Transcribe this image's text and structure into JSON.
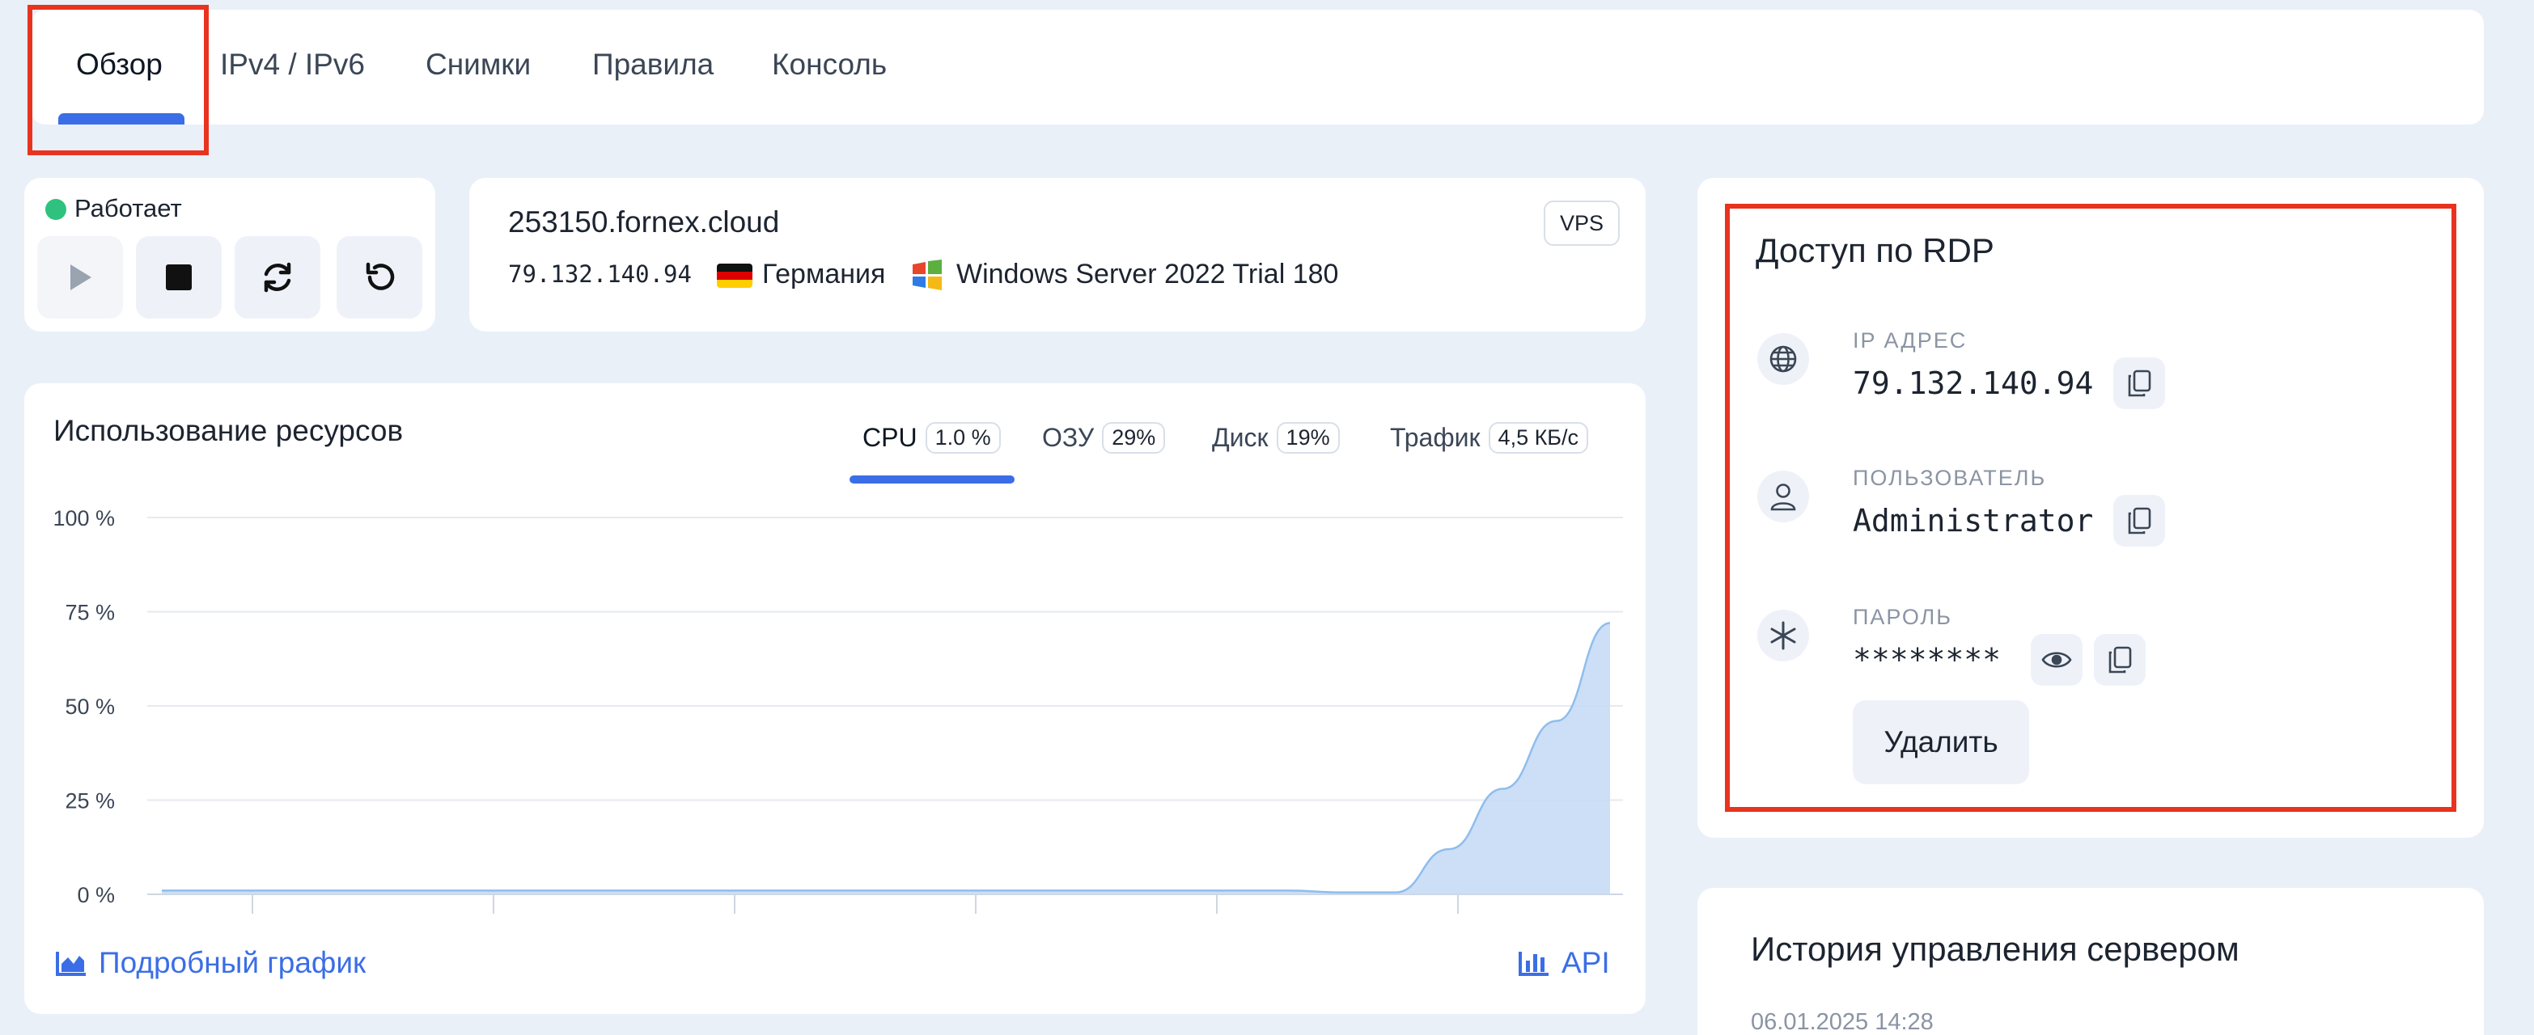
{
  "tabs": [
    {
      "label": "Обзор",
      "active": true
    },
    {
      "label": "IPv4 / IPv6"
    },
    {
      "label": "Снимки"
    },
    {
      "label": "Правила"
    },
    {
      "label": "Консоль"
    }
  ],
  "controls": {
    "status": "Работает",
    "status_color": "#2ec27e",
    "buttons": [
      "play-icon",
      "stop-icon",
      "refresh-icon",
      "undo-icon"
    ]
  },
  "server": {
    "hostname": "253150.fornex.cloud",
    "badge": "VPS",
    "ip": "79.132.140.94",
    "country": "Германия",
    "os": "Windows Server 2022 Trial 180"
  },
  "resources": {
    "title": "Использование ресурсов",
    "metrics": [
      {
        "label": "CPU",
        "value": "1.0 %",
        "active": true
      },
      {
        "label": "ОЗУ",
        "value": "29%"
      },
      {
        "label": "Диск",
        "value": "19%"
      },
      {
        "label": "Трафик",
        "value": "4,5 КБ/с"
      }
    ],
    "detail_link": "Подробный график",
    "api_link": "API"
  },
  "chart_data": {
    "type": "area",
    "title": "",
    "xlabel": "",
    "ylabel": "",
    "yticks": [
      "100 %",
      "75 %",
      "50 %",
      "25 %",
      "0 %"
    ],
    "ylim": [
      0,
      100
    ],
    "grid": true,
    "series": [
      {
        "values": [
          1,
          1,
          1,
          1,
          1,
          1,
          1,
          1,
          1,
          1,
          1,
          1,
          1,
          1,
          1,
          1,
          1,
          1,
          1,
          1,
          1,
          1,
          0.5,
          0.5,
          12,
          28,
          46,
          72
        ]
      }
    ],
    "color": "#3b8ee6"
  },
  "rdp": {
    "title": "Доступ по RDP",
    "ip_label": "IP АДРЕС",
    "ip_value": "79.132.140.94",
    "user_label": "ПОЛЬЗОВАТЕЛЬ",
    "user_value": "Administrator",
    "pass_label": "ПАРОЛЬ",
    "pass_value": "********",
    "delete_label": "Удалить"
  },
  "history": {
    "title": "История управления сервером",
    "date": "06.01.2025 14:28"
  },
  "colors": {
    "accent": "#3b6ee6",
    "highlight": "#e8331f",
    "background": "#eaf0f8"
  }
}
